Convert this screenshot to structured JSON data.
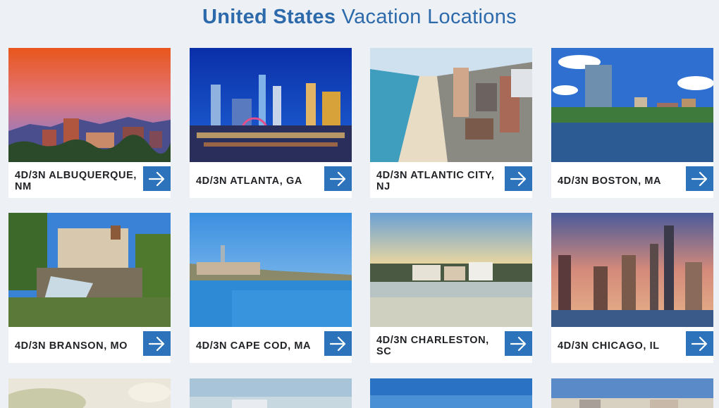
{
  "header": {
    "title_bold": "United States",
    "title_light": "Vacation Locations"
  },
  "colors": {
    "accent": "#2d73bb",
    "title": "#2d6aab",
    "background": "#edf0f4"
  },
  "locations": [
    {
      "label": "4D/3N ALBUQUERQUE, NM",
      "icon": "arrow-right-icon"
    },
    {
      "label": "4D/3N ATLANTA, GA",
      "icon": "arrow-right-icon"
    },
    {
      "label": "4D/3N ATLANTIC CITY, NJ",
      "icon": "arrow-right-icon"
    },
    {
      "label": "4D/3N BOSTON, MA",
      "icon": "arrow-right-icon"
    },
    {
      "label": "4D/3N BRANSON, MO",
      "icon": "arrow-right-icon"
    },
    {
      "label": "4D/3N CAPE COD, MA",
      "icon": "arrow-right-icon"
    },
    {
      "label": "4D/3N CHARLESTON, SC",
      "icon": "arrow-right-icon"
    },
    {
      "label": "4D/3N CHICAGO, IL",
      "icon": "arrow-right-icon"
    }
  ]
}
